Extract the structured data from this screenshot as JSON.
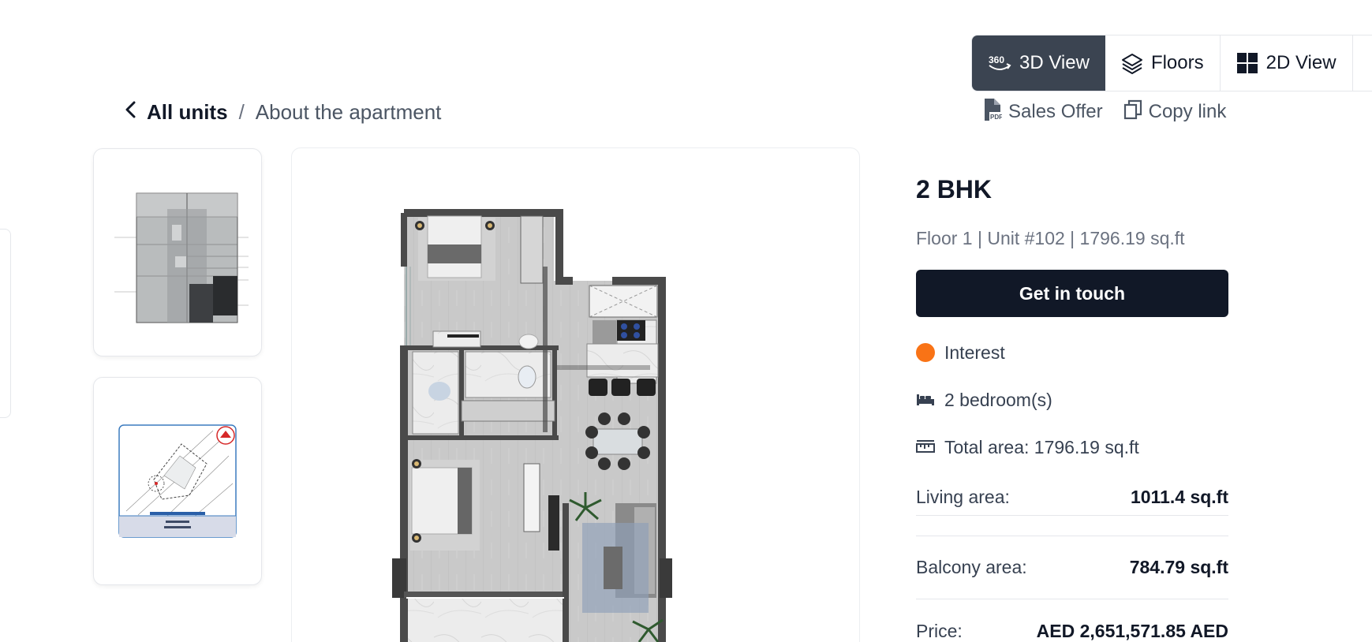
{
  "view_toggle": {
    "items": [
      {
        "label": "3D View",
        "icon": "360-icon",
        "active": true
      },
      {
        "label": "Floors",
        "icon": "layers-icon",
        "active": false
      },
      {
        "label": "2D View",
        "icon": "grid-icon",
        "active": false
      }
    ]
  },
  "breadcrumb": {
    "back_label": "All units",
    "separator": "/",
    "current": "About the apartment"
  },
  "actions": {
    "sales_offer": "Sales Offer",
    "copy_link": "Copy link"
  },
  "thumbnails": [
    {
      "name": "floor-plan-thumbnail"
    },
    {
      "name": "site-map-thumbnail"
    }
  ],
  "unit": {
    "title": "2 BHK",
    "subtitle": "Floor 1 | Unit #102 | 1796.19 sq.ft",
    "cta_label": "Get in touch",
    "status": "Interest",
    "status_color": "#f97316",
    "bedrooms": "2 bedroom(s)",
    "total_area": "Total area: 1796.19 sq.ft",
    "details": [
      {
        "label": "Living area:",
        "value": "1011.4 sq.ft"
      },
      {
        "label": "Balcony area:",
        "value": "784.79 sq.ft"
      },
      {
        "label": "Price:",
        "value": "AED 2,651,571.85 AED"
      }
    ]
  },
  "colors": {
    "active_toggle": "#3b4451",
    "cta_bg": "#111827",
    "accent": "#f97316"
  }
}
